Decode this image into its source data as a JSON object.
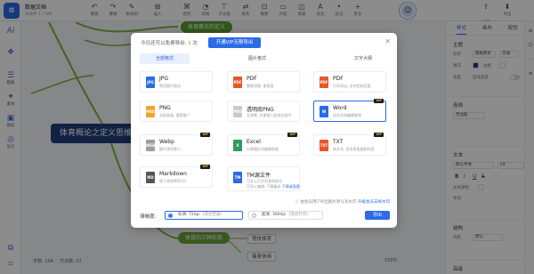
{
  "app": {
    "doc_name": "数据文档",
    "doc_sub": "未保存 1.7 MB",
    "avatar": "☺"
  },
  "toolbar": {
    "items": [
      {
        "icon": "↶",
        "label": "撤销"
      },
      {
        "icon": "↷",
        "label": "重做"
      },
      {
        "icon": "✎",
        "label": "格式刷"
      },
      {
        "icon": "⊞",
        "label": "插入"
      },
      {
        "icon": "⌘",
        "label": "结构"
      },
      {
        "icon": "◔",
        "label": "风格"
      },
      {
        "icon": "⊤",
        "label": "子主题"
      },
      {
        "icon": "⇄",
        "label": "联系"
      },
      {
        "icon": "⊡",
        "label": "概要"
      },
      {
        "icon": "▭",
        "label": "外框"
      },
      {
        "icon": "◫",
        "label": "关联"
      },
      {
        "icon": "A",
        "label": "美化"
      },
      {
        "icon": "•",
        "label": "标记"
      },
      {
        "icon": "+",
        "label": "更多"
      }
    ],
    "right": [
      {
        "icon": "⇪",
        "label": "分享"
      },
      {
        "icon": "⬇",
        "label": "导出"
      }
    ]
  },
  "left_rail": [
    {
      "icon": "Ai",
      "label": ""
    },
    {
      "icon": "❖",
      "label": ""
    },
    {
      "icon": "☰",
      "label": "模板"
    },
    {
      "icon": "✦",
      "label": "素材"
    },
    {
      "icon": "▣",
      "label": "图标"
    },
    {
      "icon": "◎",
      "label": "设计"
    },
    {
      "icon": "⧉",
      "label": ""
    },
    {
      "icon": "⌗",
      "label": ""
    }
  ],
  "right_panel": {
    "tabs": [
      "样式",
      "画布",
      "配色"
    ],
    "sec_topic": "主题",
    "shape_label": "形状",
    "shape_value": "圆角矩形",
    "fill_label": "填充",
    "border_label": "边框",
    "border_value": "实线",
    "width_label": "宽度",
    "auto_width": "自动宽度",
    "sec_branch": "连线",
    "branch_value": "无边框",
    "sec_text": "文本",
    "font_label": "字体",
    "font_value": "默认字体",
    "size_value": "24",
    "bold": "B",
    "italic": "I",
    "underline": "U",
    "strike": "S",
    "color_label": "文本颜色",
    "layout_label": "布局",
    "sec_layout": "结构",
    "align_label": "对齐",
    "space_label": "间距",
    "space_value": "默认",
    "sec_more": "高级"
  },
  "canvas": {
    "central_topic": "体育概论之定义思维",
    "branch_top": "体育概论的定义",
    "branch_bottom": "体育的三种形态",
    "leaf_1": "竞技体育",
    "leaf_2": "健身休闲",
    "word_count": "字数: 194",
    "node_count": "节点数: 22",
    "zoom": "100%"
  },
  "dialog": {
    "quota_prefix": "今日还可以免费导出:",
    "quota_num": "1",
    "quota_unit": "次",
    "vip_button": "开通VIP无限导出",
    "close": "✕",
    "tabs": [
      "全部格式",
      "图片格式",
      "文字大纲"
    ],
    "formats": [
      {
        "name": "JPG",
        "desc": "常用图片格式",
        "badge": "JPG",
        "color": "#2b6be6",
        "vip": false
      },
      {
        "name": "PDF",
        "desc": "整版排版, 更易用",
        "badge": "PDF",
        "color": "#e8562a",
        "vip": false
      },
      {
        "name": "PDF",
        "desc": "打印导出, 支持定制页面",
        "badge": "PDF",
        "color": "#e8562a",
        "vip": false
      },
      {
        "name": "PNG",
        "desc": "无损高清, 通用推广",
        "badge": "PNG",
        "color": "#f0a52a",
        "vip": false
      },
      {
        "name": "透明底PNG",
        "desc": "无背景, 方便放入其他文档中",
        "badge": "PNG",
        "color": "#c9c9c9",
        "vip": false
      },
      {
        "name": "Word",
        "desc": "适合文档编辑查阅",
        "badge": "W",
        "color": "#2b6be6",
        "vip": true
      },
      {
        "name": "Webp",
        "desc": "图片体积更小",
        "badge": "WEB",
        "color": "#9e9e9e",
        "vip": true
      },
      {
        "name": "Excel",
        "desc": "以表格形式编辑思维",
        "badge": "X",
        "color": "#2e9d57",
        "vip": true
      },
      {
        "name": "TXT",
        "desc": "纯文本, 适合直接复制内容",
        "badge": "TXT",
        "color": "#e8562a",
        "vip": true
      },
      {
        "name": "Markdown",
        "desc": "便于其他MD打开",
        "badge": "MD",
        "color": "#555555",
        "vip": true
      },
      {
        "name": "TM源文件",
        "desc": "可导入编辑, 下载备份",
        "desc_prefix": "可导入打开在其他账号",
        "link": "下载桌面版",
        "badge": "TM",
        "color": "#2b6be6",
        "vip": false
      }
    ],
    "vip_tag": "VIP",
    "note_prefix": "ⓘ 由会员用户导出图片默认有水印",
    "note_link": "升级会员去掉水印",
    "resolution_label": "清晰度:",
    "res_options": [
      {
        "label": "标清: 72dpi",
        "tag": "(适合普通)"
      },
      {
        "label": "超清: 300dpi",
        "tag": "(适合打印)"
      }
    ],
    "export_button": "导出"
  },
  "strip": [
    "⊕",
    "☺",
    "⋯",
    "≡"
  ]
}
